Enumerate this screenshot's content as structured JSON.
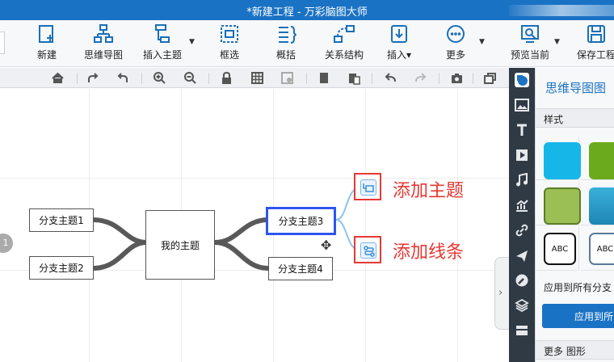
{
  "window": {
    "title": "*新建工程 - 万彩脑图大师"
  },
  "toolbar": {
    "items": [
      {
        "label": "新建",
        "icon": "new-icon"
      },
      {
        "label": "思维导图",
        "icon": "mindmap-icon"
      },
      {
        "label": "插入主题",
        "icon": "insert-topic-icon"
      },
      {
        "label": "框选",
        "icon": "frame-select-icon"
      },
      {
        "label": "概括",
        "icon": "summary-icon"
      },
      {
        "label": "关系结构",
        "icon": "relation-icon"
      },
      {
        "label": "插入▾",
        "icon": "insert-icon"
      },
      {
        "label": "更多",
        "icon": "more-icon"
      },
      {
        "label": "预览当前",
        "icon": "preview-icon"
      },
      {
        "label": "保存工程",
        "icon": "save-icon"
      }
    ]
  },
  "subtoolbar": {
    "icons": [
      "home-icon",
      "redo-arrow-icon",
      "undo-arrow-icon",
      "zoom-in-icon",
      "zoom-out-icon",
      "lock-icon",
      "grid-icon",
      "image-grid-icon",
      "copy-icon",
      "paste-icon",
      "undo-icon",
      "redo-icon",
      "camera-icon",
      "window-icon"
    ]
  },
  "mindmap": {
    "central_topic": "我的主题",
    "branches": [
      "分支主题1",
      "分支主题2",
      "分支主题3",
      "分支主题4"
    ],
    "selected_branch": "分支主题3",
    "badge": "1"
  },
  "annotations": {
    "add_topic": "添加主题",
    "add_line": "添加线条"
  },
  "side_strip": {
    "icons": [
      "style-icon",
      "image-icon",
      "text-icon",
      "video-icon",
      "music-icon",
      "chart-icon",
      "link-icon",
      "plane-icon",
      "tool-icon",
      "layers-icon",
      "stack-icon"
    ]
  },
  "panel": {
    "title": "思维导图图",
    "style_section": "样式",
    "swatches": [
      "#16b6e8",
      "#6aaa1c",
      "#9bbe55",
      "#2d9cc8"
    ],
    "abc_label": "ABC",
    "apply_all_section": "应用到所有分支",
    "apply_button": "应用到所",
    "more_section": "更多 图形"
  },
  "colors": {
    "accent": "#1a72c4",
    "annotation": "#e53935",
    "selection": "#2f55f0"
  }
}
